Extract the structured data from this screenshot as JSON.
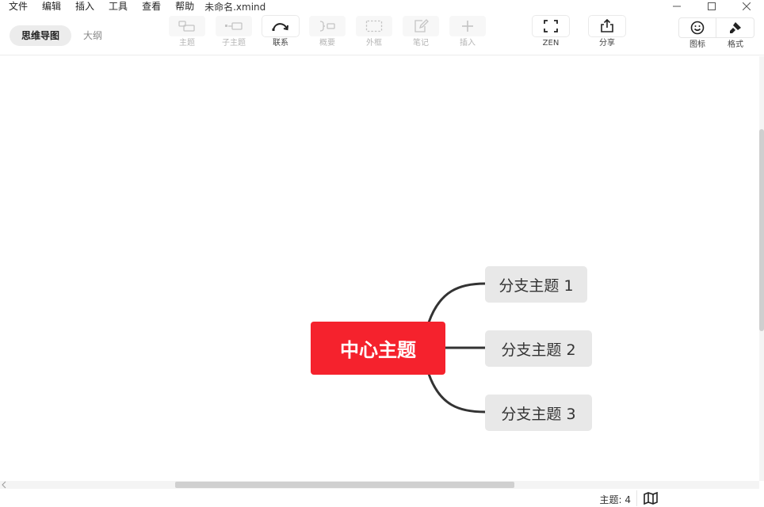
{
  "menu": [
    "文件",
    "编辑",
    "插入",
    "工具",
    "查看",
    "帮助"
  ],
  "filename": "未命名.xmind",
  "window": {
    "minimize": "—",
    "maximize": "☐",
    "close": "✕"
  },
  "views": {
    "mindmap": "思维导图",
    "outline": "大纲"
  },
  "tools": {
    "topic": "主题",
    "subtopic": "子主题",
    "relationship": "联系",
    "summary": "概要",
    "boundary": "外框",
    "note": "笔记",
    "insert": "插入",
    "zen": "ZEN",
    "share": "分享"
  },
  "panel": {
    "icons": "图标",
    "format": "格式"
  },
  "map": {
    "central": "中心主题",
    "branches": [
      "分支主题 1",
      "分支主题 2",
      "分支主题 3"
    ]
  },
  "status": {
    "topic_count": "主题: 4"
  },
  "colors": {
    "central_topic": "#f5222d",
    "branch_topic": "#e8e8e8",
    "connector": "#333333"
  }
}
